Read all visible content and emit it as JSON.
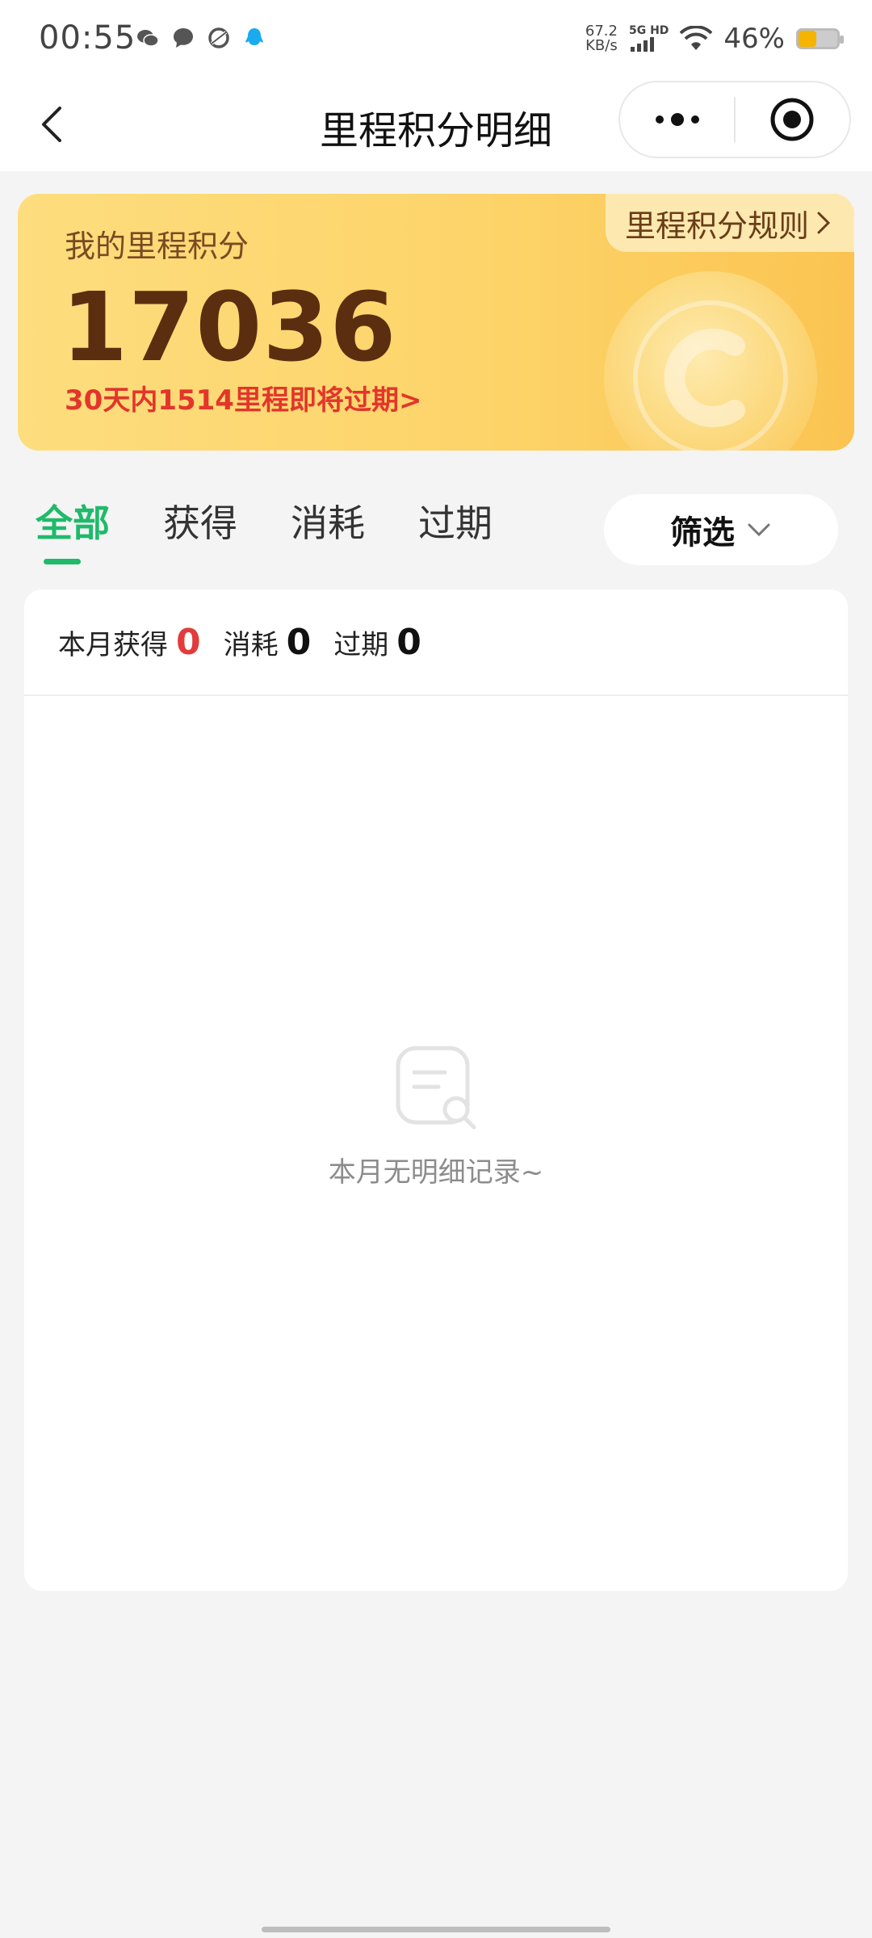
{
  "status_bar": {
    "time": "00:55",
    "net_speed_value": "67.2",
    "net_speed_unit": "KB/s",
    "network": "5G HD",
    "battery_text": "46%",
    "battery_level": 0.46,
    "app_icons": [
      "wechat-icon",
      "chat-bubble-icon",
      "sync-icon",
      "qq-icon"
    ]
  },
  "nav": {
    "title": "里程积分明细",
    "more_icon": "more-dots-icon",
    "close_icon": "target-close-icon"
  },
  "points_card": {
    "label": "我的里程积分",
    "value": "17036",
    "expire_notice": "30天内1514里程即将过期>",
    "rules_link": "里程积分规则"
  },
  "tabs": [
    {
      "label": "全部",
      "active": true
    },
    {
      "label": "获得",
      "active": false
    },
    {
      "label": "消耗",
      "active": false
    },
    {
      "label": "过期",
      "active": false
    }
  ],
  "filter": {
    "label": "筛选"
  },
  "summary": {
    "earned_label": "本月获得",
    "earned_value": "0",
    "consumed_label": "消耗",
    "consumed_value": "0",
    "expired_label": "过期",
    "expired_value": "0"
  },
  "empty_state": {
    "text": "本月无明细记录~",
    "icon": "document-search-icon"
  },
  "colors": {
    "accent_green": "#1fba6a",
    "alert_red": "#e2362b",
    "card_gold": "#fdd46a"
  }
}
